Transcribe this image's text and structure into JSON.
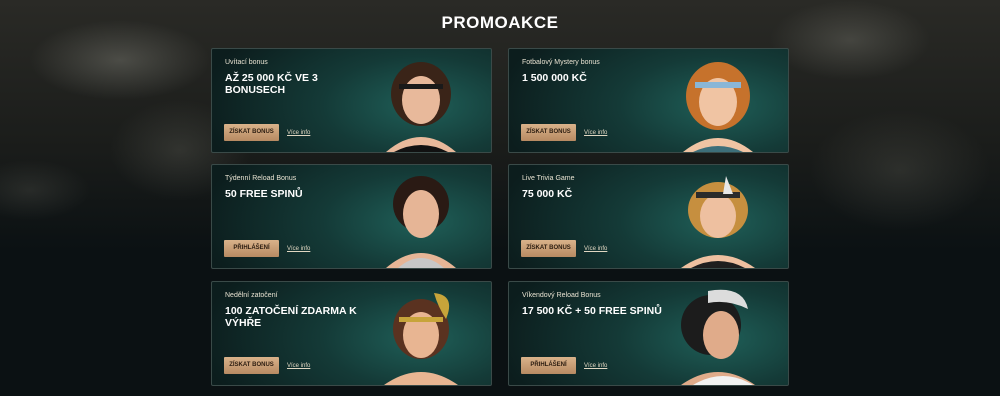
{
  "page": {
    "title": "PROMOAKCE"
  },
  "promos": [
    {
      "subtitle": "Uvítací bonus",
      "offer": "AŽ 25 000 KČ VE 3 BONUSECH",
      "button": "ZÍSKAT BONUS",
      "link": "Více info",
      "hair": "#3a2418",
      "accent": "#1a1a1a"
    },
    {
      "subtitle": "Fotbalový Mystery bonus",
      "offer": "1 500 000 KČ",
      "button": "ZÍSKAT BONUS",
      "link": "Více info",
      "hair": "#c6722c",
      "accent": "#8ab6d6"
    },
    {
      "subtitle": "Týdenní Reload Bonus",
      "offer": "50 FREE SPINŮ",
      "button": "PŘIHLÁŠENÍ",
      "link": "Více info",
      "hair": "#2a1a14",
      "accent": "#c7c7c7"
    },
    {
      "subtitle": "Live Trivia Game",
      "offer": "75 000 KČ",
      "button": "ZÍSKAT BONUS",
      "link": "Více info",
      "hair": "#c68f3f",
      "accent": "#2b2b2b"
    },
    {
      "subtitle": "Nedělní zatočení",
      "offer": "100 ZATOČENÍ ZDARMA K VÝHŘE",
      "button": "ZÍSKAT BONUS",
      "link": "Více info",
      "hair": "#5a3220",
      "accent": "#c7a43a"
    },
    {
      "subtitle": "Víkendový Reload Bonus",
      "offer": "17 500 KČ + 50 FREE SPINŮ",
      "button": "PŘIHLÁŠENÍ",
      "link": "Více info",
      "hair": "#1c1c1c",
      "accent": "#dcdcdc"
    }
  ]
}
